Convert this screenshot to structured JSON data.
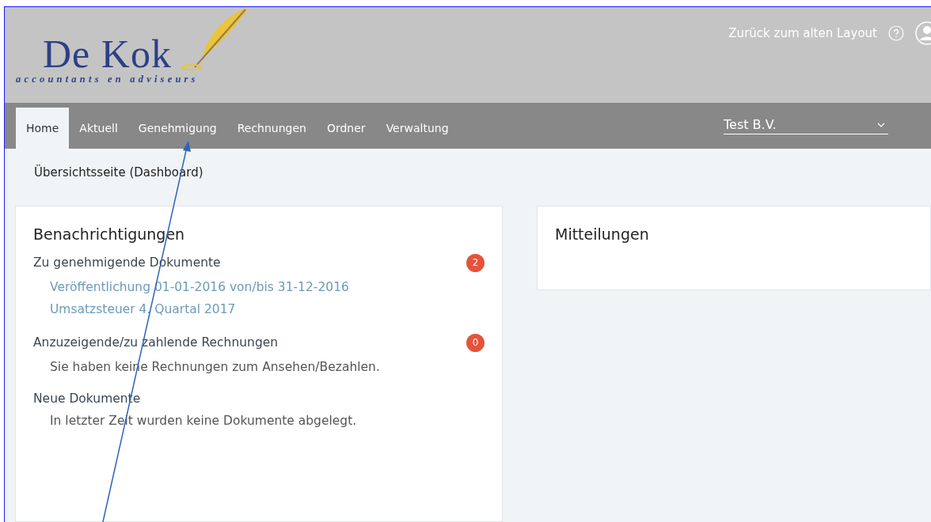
{
  "logo": {
    "name": "De Kok",
    "tagline": "accountants en adviseurs"
  },
  "header_links": {
    "back_link": "Zurück zum alten Layout"
  },
  "nav": {
    "tabs": [
      {
        "label": "Home",
        "selected": true
      },
      {
        "label": "Aktuell",
        "selected": false
      },
      {
        "label": "Genehmigung",
        "selected": false
      },
      {
        "label": "Rechnungen",
        "selected": false
      },
      {
        "label": "Ordner",
        "selected": false
      },
      {
        "label": "Verwaltung",
        "selected": false
      }
    ],
    "company_select": {
      "value": "Test B.V."
    }
  },
  "breadcrumb": "Übersichtsseite (Dashboard)",
  "notifications": {
    "title": "Benachrichtigungen",
    "sections": [
      {
        "title": "Zu genehmigende Dokumente",
        "badge": "2",
        "items": [
          {
            "kind": "link",
            "text": "Veröffentlichung 01-01-2016 von/bis 31-12-2016"
          },
          {
            "kind": "link",
            "text": "Umsatzsteuer 4. Quartal 2017"
          }
        ]
      },
      {
        "title": "Anzuzeigende/zu zahlende Rechnungen",
        "badge": "0",
        "items": [
          {
            "kind": "text",
            "text": "Sie haben keine Rechnungen zum Ansehen/Bezahlen."
          }
        ]
      },
      {
        "title": "Neue Dokumente",
        "items": [
          {
            "kind": "text",
            "text": "In letzter Zeit wurden keine Dokumente abgelegt."
          }
        ]
      }
    ]
  },
  "messages": {
    "title": "Mitteilungen"
  }
}
